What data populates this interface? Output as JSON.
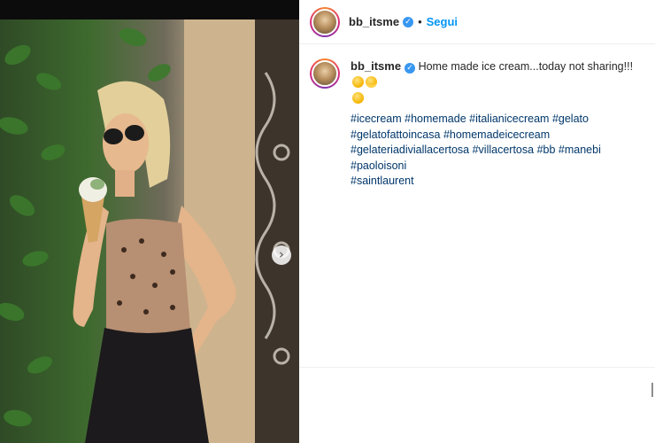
{
  "post": {
    "username": "bb_itsme",
    "verified_glyph": "✓",
    "separator": "•",
    "follow_label": "Segui",
    "caption_text": "Home made ice cream...today not sharing!!!",
    "caption_emojis": [
      "grinning-squint-emoji",
      "sunglasses-emoji",
      "yum-emoji"
    ],
    "hashtags": [
      "#icecream",
      "#homemade",
      "#italianicecream",
      "#gelato",
      "#gelatofattoincasa",
      "#homemadeicecream",
      "#gelateriadiviallacertosa",
      "#villacertosa",
      "#bb",
      "#manebi",
      "#paoloisoni",
      "#saintlaurent"
    ]
  },
  "media": {
    "next_arrow_glyph": "›",
    "icon": "chevron-right-icon"
  },
  "colors": {
    "link_blue": "#0095f6",
    "hashtag_blue": "#00376b",
    "verified_blue": "#3897f0",
    "text": "#262626"
  }
}
